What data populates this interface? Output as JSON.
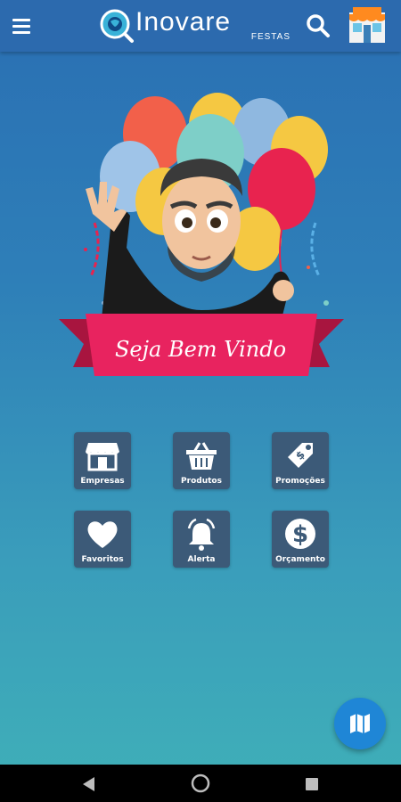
{
  "header": {
    "logo_text": "Inovare",
    "logo_subtext": "FESTAS",
    "menu_icon": "hamburger-menu-icon",
    "search_icon": "search-icon",
    "store_icon": "storefront-icon"
  },
  "hero": {
    "welcome_text": "Seja Bem Vindo",
    "image": "balloons-avatar-illustration"
  },
  "menu": {
    "items": [
      {
        "label": "Empresas",
        "icon": "store-icon"
      },
      {
        "label": "Produtos",
        "icon": "basket-icon"
      },
      {
        "label": "Promoções",
        "icon": "price-tag-icon"
      },
      {
        "label": "Favoritos",
        "icon": "heart-icon"
      },
      {
        "label": "Alerta",
        "icon": "bell-icon"
      },
      {
        "label": "Orçamento",
        "icon": "dollar-icon"
      }
    ]
  },
  "fab": {
    "icon": "map-icon"
  },
  "system_nav": {
    "back": "back-icon",
    "home": "home-icon",
    "recents": "recents-icon"
  },
  "colors": {
    "appbar": "#2c6aae",
    "tile": "#3c5a78",
    "banner": "#e8235f",
    "fab": "#1f86d6"
  }
}
